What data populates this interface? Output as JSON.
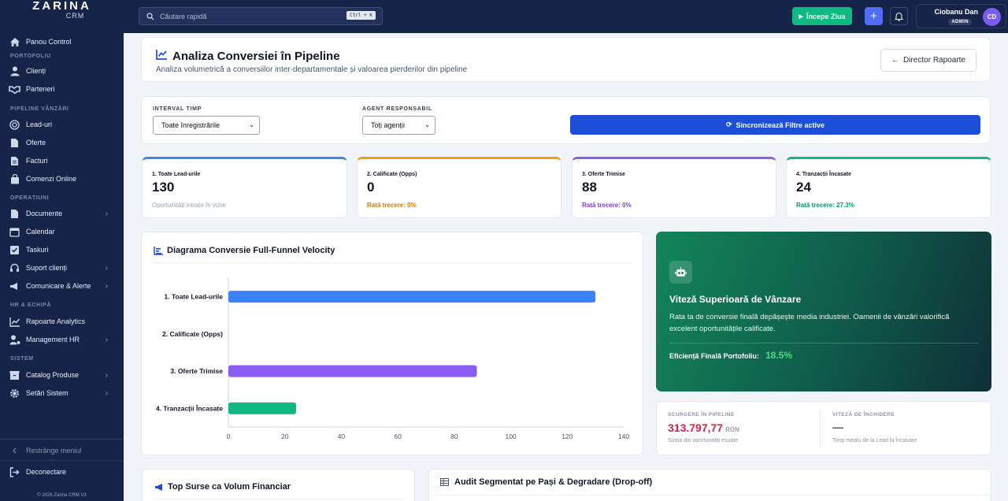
{
  "sidebar": {
    "logo_name": "ZARINA",
    "logo_sub": "CRM",
    "items": [
      {
        "label": "Panou Control",
        "icon": "home-icon"
      },
      {
        "label": "Clienți",
        "icon": "user-icon"
      },
      {
        "label": "Parteneri",
        "icon": "handshake-icon"
      },
      {
        "label": "Lead-uri",
        "icon": "target-icon"
      },
      {
        "label": "Oferte",
        "icon": "file-icon"
      },
      {
        "label": "Facturi",
        "icon": "invoice-icon"
      },
      {
        "label": "Comenzi Online",
        "icon": "bag-icon"
      },
      {
        "label": "Documente",
        "icon": "document-icon"
      },
      {
        "label": "Calendar",
        "icon": "calendar-icon"
      },
      {
        "label": "Taskuri",
        "icon": "check-square-icon"
      },
      {
        "label": "Suport clienți",
        "icon": "support-icon"
      },
      {
        "label": "Comunicare & Alerte",
        "icon": "megaphone-icon"
      },
      {
        "label": "Rapoarte Analytics",
        "icon": "chart-line-icon"
      },
      {
        "label": "Management HR",
        "icon": "user-gear-icon"
      },
      {
        "label": "Catalog Produse",
        "icon": "box-icon"
      },
      {
        "label": "Setări Sistem",
        "icon": "gear-icon"
      }
    ],
    "sections": [
      "PORTOFOLIU",
      "PIPELINE VÂNZĂRI",
      "OPERAȚIUNI",
      "HR & ECHIPĂ",
      "SISTEM"
    ],
    "collapse_label": "Restrânge meniul",
    "logout_label": "Deconectare",
    "copyright": "© 2026 Zarina CRM V3"
  },
  "topbar": {
    "search_placeholder": "Căutare rapidă",
    "shortcut": "Ctrl + K",
    "start_day": "Începe Ziua",
    "user_name": "Ciobanu Dan",
    "user_role": "ADMIN",
    "user_initials": "CD"
  },
  "header": {
    "title": "Analiza Conversiei în Pipeline",
    "subtitle": "Analiza volumetrică a conversiilor inter-departamentale și valoarea pierderilor din pipeline",
    "back_label": "Director Rapoarte"
  },
  "filters": {
    "interval_label": "INTERVAL TIMP",
    "interval_value": "Toate înregistrările",
    "agent_label": "AGENT RESPONSABIL",
    "agent_value": "Toți agenții",
    "sync_label": "Sincronizează Filtre active"
  },
  "kpis": [
    {
      "label": "1. Toate Lead-urile",
      "value": "130",
      "sub": "Oportunități intrate în vizor",
      "color": "#3b82f6",
      "sub_color": "#94a3b8"
    },
    {
      "label": "2. Calificate (Opps)",
      "value": "0",
      "sub": "Rată trecere: 0%",
      "color": "#f59e0b",
      "sub_color": "#d97706"
    },
    {
      "label": "3. Oferte Trimise",
      "value": "88",
      "sub": "Rată trecere: 0%",
      "color": "#8b5cf6",
      "sub_color": "#7c3aed"
    },
    {
      "label": "4. Tranzacții Încasate",
      "value": "24",
      "sub": "Rată trecere: 27.3%",
      "color": "#10b981",
      "sub_color": "#059669"
    }
  ],
  "funnel": {
    "title": "Diagrama Conversie Full-Funnel Velocity"
  },
  "chart_data": {
    "type": "bar",
    "orientation": "horizontal",
    "categories": [
      "1. Toate Lead-urile",
      "2. Calificate (Opps)",
      "3. Oferte Trimise",
      "4. Tranzacții Încasate"
    ],
    "values": [
      130,
      0,
      88,
      24
    ],
    "colors": [
      "#3b82f6",
      "#f59e0b",
      "#8b5cf6",
      "#10b981"
    ],
    "xlim": [
      0,
      140
    ],
    "xticks": [
      0,
      20,
      40,
      60,
      80,
      100,
      120,
      140
    ],
    "grid": false
  },
  "insight": {
    "title": "Viteză Superioară de Vânzare",
    "desc": "Rata ta de conversie finală depășește media industriei. Oamenii de vânzări valorifică excelent oportunitățile calificate.",
    "eff_label": "Eficiență Finală Portofoliu:",
    "eff_value": "18.5%"
  },
  "metrics": {
    "leak_label": "SCURGERE ÎN PIPELINE",
    "leak_value": "313.797,77",
    "leak_unit": "RON",
    "leak_sub": "Suma din oportunități eșuate",
    "speed_label": "VITEZĂ DE ÎNCHIDERE",
    "speed_value": "—",
    "speed_sub": "Timp mediu de la Lead la Încasare"
  },
  "bottom": {
    "sources_title": "Top Surse ca Volum Financiar",
    "audit_title": "Audit Segmentat pe Pași & Degradare (Drop-off)"
  }
}
